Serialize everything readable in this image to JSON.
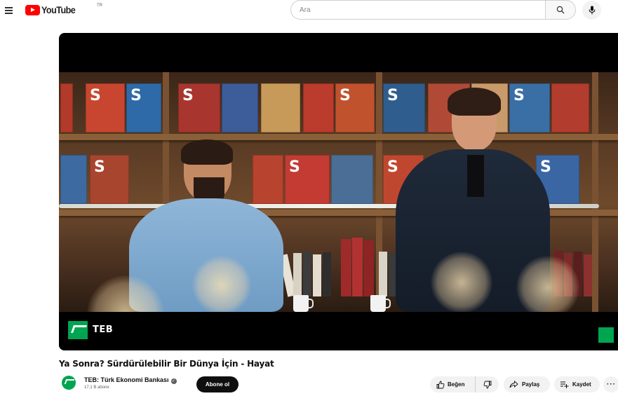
{
  "header": {
    "logo_text": "YouTube",
    "logo_tm": "TR",
    "search_placeholder": "Ara"
  },
  "player": {
    "overlay_brand": "TEB"
  },
  "video": {
    "title": "Ya Sonra? Sürdürülebilir Bir Dünya İçin - Hayat"
  },
  "channel": {
    "name": "TEB: Türk Ekonomi Bankası",
    "subscribers": "17,1 B abone",
    "subscribe_label": "Abone ol"
  },
  "actions": {
    "like_label": "Beğen",
    "share_label": "Paylaş",
    "save_label": "Kaydet",
    "more_label": "···"
  },
  "colors": {
    "brand_red": "#ff0000",
    "teb_green": "#00a551",
    "subscribe_bg": "#0f0f0f"
  }
}
